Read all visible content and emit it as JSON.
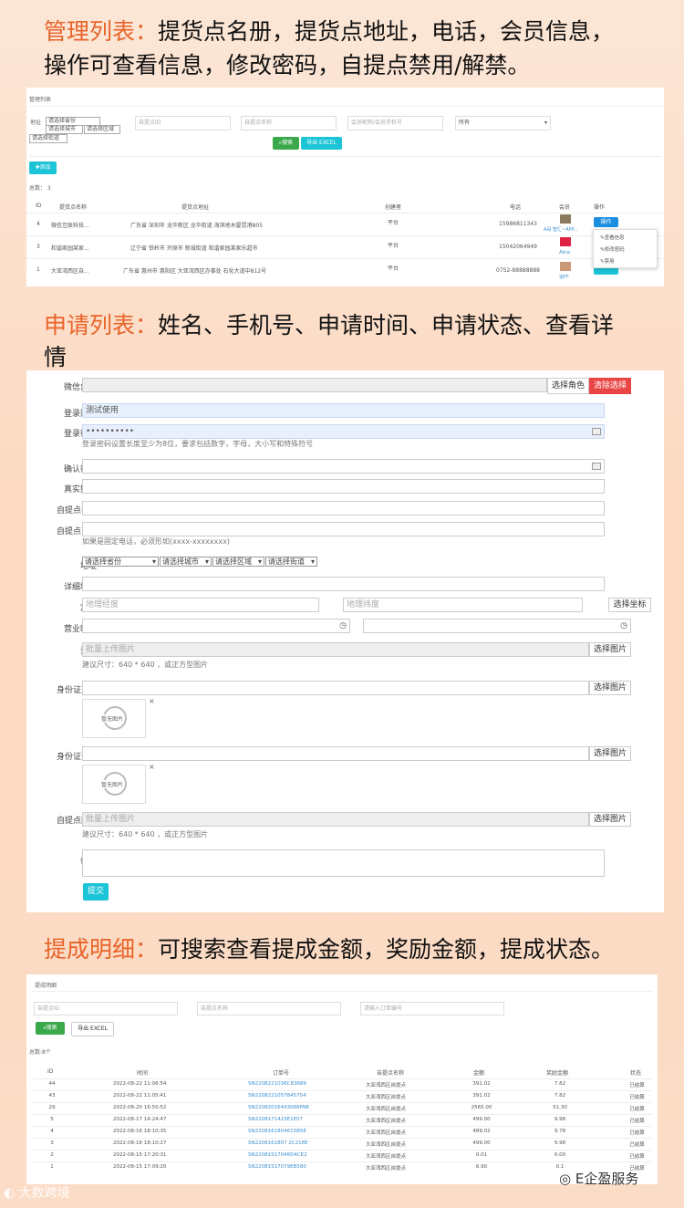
{
  "sec1": {
    "heading_hl": "管理列表：",
    "heading_rest": "提货点名册，提货点地址，电话，会员信息，",
    "heading_line2": "操作可查看信息，修改密码，自提点禁用/解禁。",
    "title": "管理列表",
    "filter": {
      "addr_label": "地址",
      "prov": "请选择省份",
      "city": "请选择城市",
      "area": "请选择区域",
      "street": "请选择街道",
      "ph1": "自提点ID",
      "ph2": "自提点名称",
      "ph3": "会员昵称/会员手机号",
      "all": "所有",
      "search": "搜索",
      "export": "导出 EXCEL"
    },
    "add_label": "添加",
    "total": "总数： 3",
    "headers": [
      "ID",
      "提货点名称",
      "提货点地址",
      "创建者",
      "电话",
      "会员",
      "操作"
    ],
    "rows": [
      {
        "id": "4",
        "name": "微信互联科技...",
        "addr": "广东省 深圳市 龙华新区 龙华街道 海滨地木厦昆港805",
        "creator": "平台",
        "phone": "15986811343",
        "member": "A哥 智汇~APP..."
      },
      {
        "id": "3",
        "name": "和谐家园某家...",
        "addr": "辽宁省 铁岭市 开原市 新城街道 和谐家园某家乐超市",
        "creator": "平台",
        "phone": "15042064949",
        "member": "Alice"
      },
      {
        "id": "1",
        "name": "大亚湾西区自...",
        "addr": "广东省 惠州市 惠阳区 大亚湾西区办事处 石化大道中812号",
        "creator": "平台",
        "phone": "0752-88888888",
        "member": "追FF"
      }
    ],
    "op_label": "操作",
    "dropdown": [
      "查看信息",
      "修改密码",
      "禁用"
    ]
  },
  "sec2": {
    "heading_hl": "申请列表：",
    "heading_rest": "姓名、手机号、申请时间、申请状态、查看详",
    "heading_line2": "情",
    "labels": {
      "role": "微信角色",
      "account": "登录账号",
      "password": "登录密码",
      "confirm": "确认密码",
      "realname": "真实姓名",
      "pickname": "自提点名称",
      "phone": "自提点电话",
      "addr": "地址",
      "detail": "详细地址",
      "locate": "定位",
      "hours": "营业时间",
      "qual": "资质",
      "idfront": "身份证正面",
      "idback": "身份证背面",
      "pickimg": "自提点图片",
      "remark": "备注"
    },
    "choose_role": "选择角色",
    "clear_choice": "清除选择",
    "account_value": "测试使用",
    "password_value": "••••••••••",
    "password_hint": "登录密码设置长度至少为8位，要求包括数字，字母，大小写和特殊符号",
    "phone_hint": "如果是固定电话，必须形如(xxxx-xxxxxxxx)",
    "prov": "请选择省份",
    "city": "请选择城市",
    "area": "请选择区域",
    "street": "请选择街道",
    "lng_ph": "地理经度",
    "lat_ph": "地理纬度",
    "choose_coord": "选择坐标",
    "batch_upload": "批量上传图片",
    "choose_img": "选择图片",
    "size_hint": "建议尺寸：640 * 640 ，或正方型图片",
    "noimg": "暂无图片",
    "submit": "提交"
  },
  "sec3": {
    "heading_hl": "提成明细：",
    "heading_rest": "可搜索查看提成金额，奖励金额，提成状态。",
    "title": "提成明细",
    "ph1": "自提点ID",
    "ph2": "自提点名称",
    "ph3": "请输入订单编号",
    "search": "搜索",
    "export": "导出 EXCEL",
    "total": "总数:8个",
    "headers": [
      "ID",
      "时间",
      "订单号",
      "自提点名称",
      "金额",
      "奖励金额",
      "状态"
    ],
    "rows": [
      {
        "id": "44",
        "time": "2022-08-22 11:06:54",
        "order": "SN2208221036C83689",
        "name": "大亚湾西区自提点",
        "amount": "391.02",
        "reward": "7.82",
        "status": "已结算"
      },
      {
        "id": "43",
        "time": "2022-08-22 11:05:41",
        "order": "SN2208221057845754",
        "name": "大亚湾西区自提点",
        "amount": "391.02",
        "reward": "7.82",
        "status": "已结算"
      },
      {
        "id": "29",
        "time": "2022-08-20 16:50:52",
        "order": "SN22082016443066FAB",
        "name": "大亚湾西区自提点",
        "amount": "2565.00",
        "reward": "51.30",
        "status": "已结算"
      },
      {
        "id": "5",
        "time": "2022-08-17 14:24:47",
        "order": "SN2208171423E1E07",
        "name": "大亚湾西区自提点",
        "amount": "499.00",
        "reward": "9.98",
        "status": "已结算"
      },
      {
        "id": "4",
        "time": "2022-08-16 18:10:35",
        "order": "SN2208161804615B5E",
        "name": "大亚湾西区自提点",
        "amount": "489.02",
        "reward": "9.78",
        "status": "已结算"
      },
      {
        "id": "3",
        "time": "2022-08-16 18:10:27",
        "order": "SN2208161807 2C218E",
        "name": "大亚湾西区自提点",
        "amount": "499.00",
        "reward": "9.98",
        "status": "已结算"
      },
      {
        "id": "2",
        "time": "2022-08-15 17:20:31",
        "order": "SN22081517046D4CE2",
        "name": "大亚湾西区自提点",
        "amount": "0.01",
        "reward": "0.00",
        "status": "已结算"
      },
      {
        "id": "1",
        "time": "2022-08-15 17:09:20",
        "order": "SN22081517079EB580",
        "name": "大亚湾西区自提点",
        "amount": "6.90",
        "reward": "0.1",
        "status": "已结算"
      }
    ]
  },
  "footer": {
    "left_wm": "大数跨境",
    "right_wm": "E企盈服务"
  },
  "colors": {
    "accent": "#e8642a",
    "teal": "#1bc4d6",
    "green": "#3aa84b",
    "red": "#e94545"
  }
}
